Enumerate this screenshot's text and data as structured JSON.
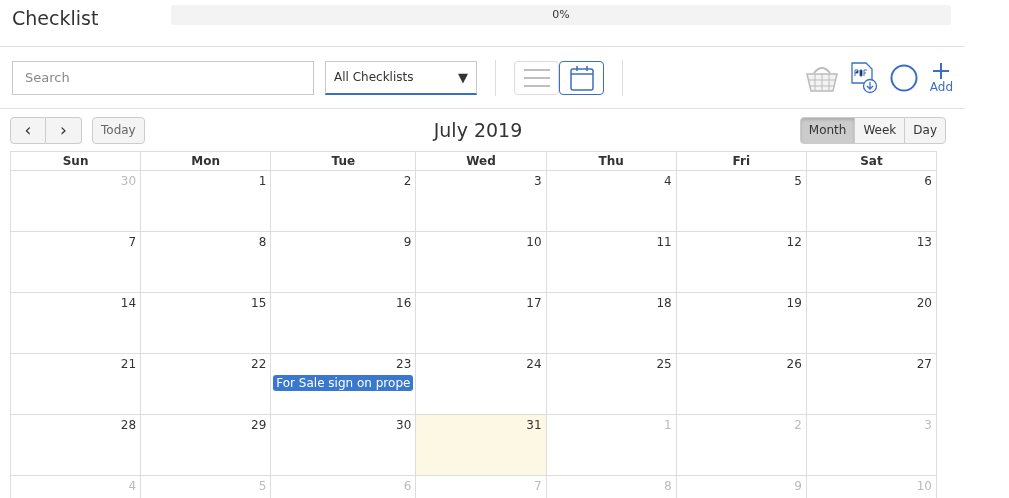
{
  "header": {
    "title": "Checklist",
    "progress": {
      "level": 0,
      "reading": "0%"
    }
  },
  "toolbar": {
    "search": {
      "placeholder": "Search"
    },
    "filter": {
      "value": "All Checklists",
      "caret": "▼"
    },
    "views": [
      {
        "kind": "list",
        "selected": false
      },
      {
        "kind": "calendar",
        "selected": true
      }
    ],
    "add_label": "Add"
  },
  "calendar": {
    "title": "July 2019",
    "today_button": "Today",
    "prev": "‹",
    "next": "›",
    "modes": [
      {
        "label": "Month",
        "selected": true
      },
      {
        "label": "Week",
        "selected": false
      },
      {
        "label": "Day",
        "selected": false
      }
    ],
    "weekdays": [
      "Sun",
      "Mon",
      "Tue",
      "Wed",
      "Thu",
      "Fri",
      "Sat"
    ],
    "weeks": [
      [
        {
          "day": "30",
          "other_month": true,
          "today": false
        },
        {
          "day": "1",
          "other_month": false,
          "today": false
        },
        {
          "day": "2",
          "other_month": false,
          "today": false
        },
        {
          "day": "3",
          "other_month": false,
          "today": false
        },
        {
          "day": "4",
          "other_month": false,
          "today": false
        },
        {
          "day": "5",
          "other_month": false,
          "today": false
        },
        {
          "day": "6",
          "other_month": false,
          "today": false
        }
      ],
      [
        {
          "day": "7",
          "other_month": false,
          "today": false
        },
        {
          "day": "8",
          "other_month": false,
          "today": false
        },
        {
          "day": "9",
          "other_month": false,
          "today": false
        },
        {
          "day": "10",
          "other_month": false,
          "today": false
        },
        {
          "day": "11",
          "other_month": false,
          "today": false
        },
        {
          "day": "12",
          "other_month": false,
          "today": false
        },
        {
          "day": "13",
          "other_month": false,
          "today": false
        }
      ],
      [
        {
          "day": "14",
          "other_month": false,
          "today": false
        },
        {
          "day": "15",
          "other_month": false,
          "today": false
        },
        {
          "day": "16",
          "other_month": false,
          "today": false
        },
        {
          "day": "17",
          "other_month": false,
          "today": false
        },
        {
          "day": "18",
          "other_month": false,
          "today": false
        },
        {
          "day": "19",
          "other_month": false,
          "today": false
        },
        {
          "day": "20",
          "other_month": false,
          "today": false
        }
      ],
      [
        {
          "day": "21",
          "other_month": false,
          "today": false
        },
        {
          "day": "22",
          "other_month": false,
          "today": false
        },
        {
          "day": "23",
          "other_month": false,
          "today": false,
          "events": [
            "For Sale sign on prope"
          ]
        },
        {
          "day": "24",
          "other_month": false,
          "today": false
        },
        {
          "day": "25",
          "other_month": false,
          "today": false
        },
        {
          "day": "26",
          "other_month": false,
          "today": false
        },
        {
          "day": "27",
          "other_month": false,
          "today": false
        }
      ],
      [
        {
          "day": "28",
          "other_month": false,
          "today": false
        },
        {
          "day": "29",
          "other_month": false,
          "today": false
        },
        {
          "day": "30",
          "other_month": false,
          "today": false
        },
        {
          "day": "31",
          "other_month": false,
          "today": true
        },
        {
          "day": "1",
          "other_month": true,
          "today": false
        },
        {
          "day": "2",
          "other_month": true,
          "today": false
        },
        {
          "day": "3",
          "other_month": true,
          "today": false
        }
      ],
      [
        {
          "day": "4",
          "other_month": true,
          "today": false
        },
        {
          "day": "5",
          "other_month": true,
          "today": false
        },
        {
          "day": "6",
          "other_month": true,
          "today": false
        },
        {
          "day": "7",
          "other_month": true,
          "today": false
        },
        {
          "day": "8",
          "other_month": true,
          "today": false
        },
        {
          "day": "9",
          "other_month": true,
          "today": false
        },
        {
          "day": "10",
          "other_month": true,
          "today": false
        }
      ]
    ]
  }
}
